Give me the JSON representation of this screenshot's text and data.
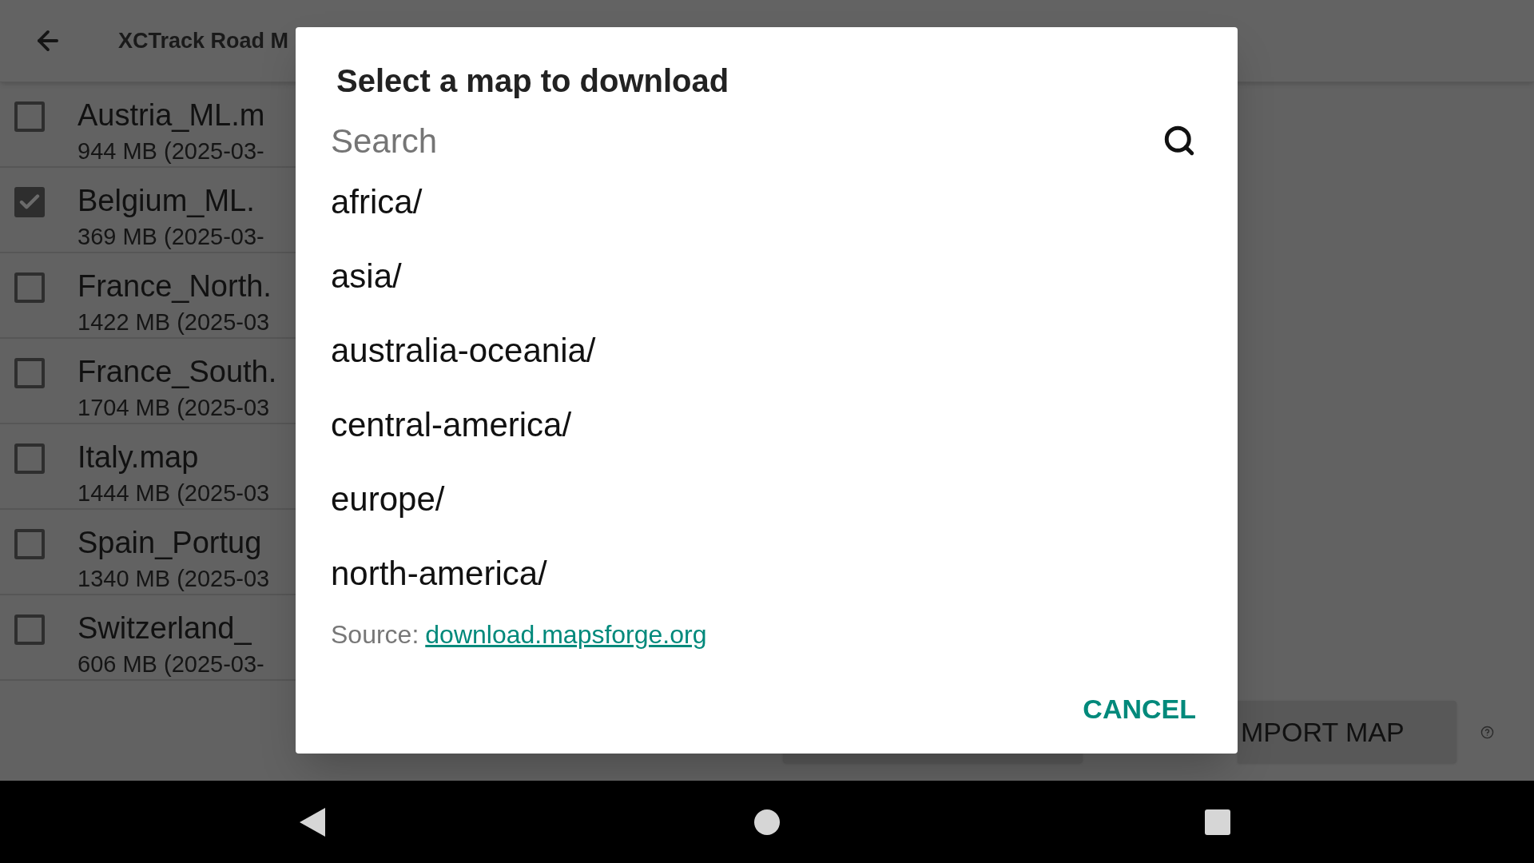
{
  "app_bar": {
    "title": "XCTrack Road M"
  },
  "maps": [
    {
      "name": "Austria_ML.m",
      "details": "944 MB (2025-03-",
      "checked": false
    },
    {
      "name": "Belgium_ML.",
      "details": "369 MB (2025-03-",
      "checked": true
    },
    {
      "name": "France_North.",
      "details": "1422 MB (2025-03",
      "checked": false
    },
    {
      "name": "France_South.",
      "details": "1704 MB (2025-03",
      "checked": false
    },
    {
      "name": "Italy.map",
      "details": "1444 MB (2025-03",
      "checked": false
    },
    {
      "name": "Spain_Portug",
      "details": "1340 MB (2025-03",
      "checked": false
    },
    {
      "name": "Switzerland_",
      "details": "606 MB (2025-03-",
      "checked": false
    }
  ],
  "import_button": {
    "label": "MPORT MAP"
  },
  "dialog": {
    "title": "Select a map to download",
    "search": {
      "placeholder": "Search"
    },
    "items": [
      "africa/",
      "asia/",
      "australia-oceania/",
      "central-america/",
      "europe/",
      "north-america/"
    ],
    "source": {
      "label": "Source:",
      "link": "download.mapsforge.org"
    },
    "cancel": "CANCEL"
  }
}
